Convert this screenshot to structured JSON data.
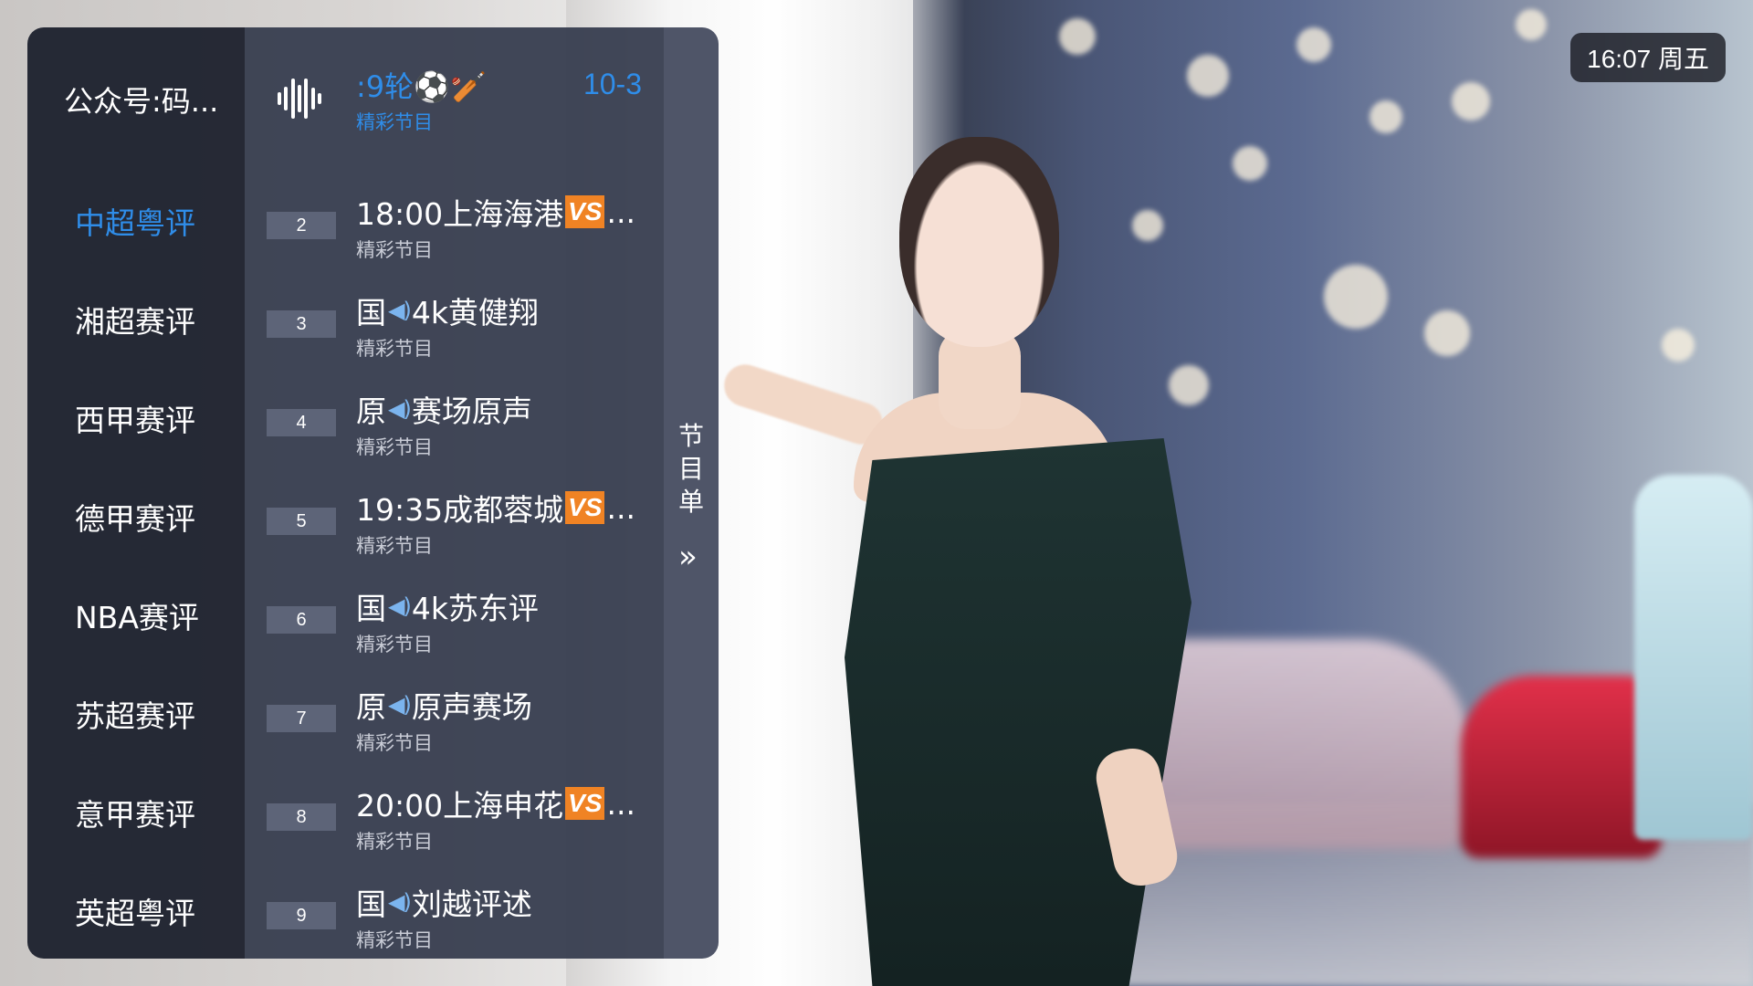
{
  "clock": {
    "text": "16:07 周五"
  },
  "categories": {
    "header": "公众号:码...",
    "items": [
      {
        "label": "中超粤评",
        "active": true
      },
      {
        "label": "湘超赛评"
      },
      {
        "label": "西甲赛评"
      },
      {
        "label": "德甲赛评"
      },
      {
        "label": "NBA赛评"
      },
      {
        "label": "苏超赛评"
      },
      {
        "label": "意甲赛评"
      },
      {
        "label": "英超粤评"
      }
    ]
  },
  "current": {
    "title": ":9轮⚽🏏",
    "number": "10-3",
    "subtitle": "精彩节目"
  },
  "channels": [
    {
      "num": "2",
      "prefix": "18:00上海海港",
      "vs": "VS",
      "speaker": "",
      "rest": "...",
      "sub": "精彩节目"
    },
    {
      "num": "3",
      "prefix": "国",
      "vs": "",
      "speaker": "◀)",
      "rest": "4k黄健翔",
      "sub": "精彩节目"
    },
    {
      "num": "4",
      "prefix": "原",
      "vs": "",
      "speaker": "◀)",
      "rest": "赛场原声",
      "sub": "精彩节目"
    },
    {
      "num": "5",
      "prefix": "19:35成都蓉城",
      "vs": "VS",
      "speaker": "",
      "rest": "...",
      "sub": "精彩节目"
    },
    {
      "num": "6",
      "prefix": "国",
      "vs": "",
      "speaker": "◀)",
      "rest": "4k苏东评",
      "sub": "精彩节目"
    },
    {
      "num": "7",
      "prefix": "原",
      "vs": "",
      "speaker": "◀)",
      "rest": "原声赛场",
      "sub": "精彩节目"
    },
    {
      "num": "8",
      "prefix": "20:00上海申花",
      "vs": "VS",
      "speaker": "",
      "rest": "...",
      "sub": "精彩节目"
    },
    {
      "num": "9",
      "prefix": "国",
      "vs": "",
      "speaker": "◀)",
      "rest": "刘越评述",
      "sub": "精彩节目"
    }
  ],
  "schedule_tab": {
    "label": "节目单",
    "arrow_icon": "double-chevron-right-icon"
  }
}
